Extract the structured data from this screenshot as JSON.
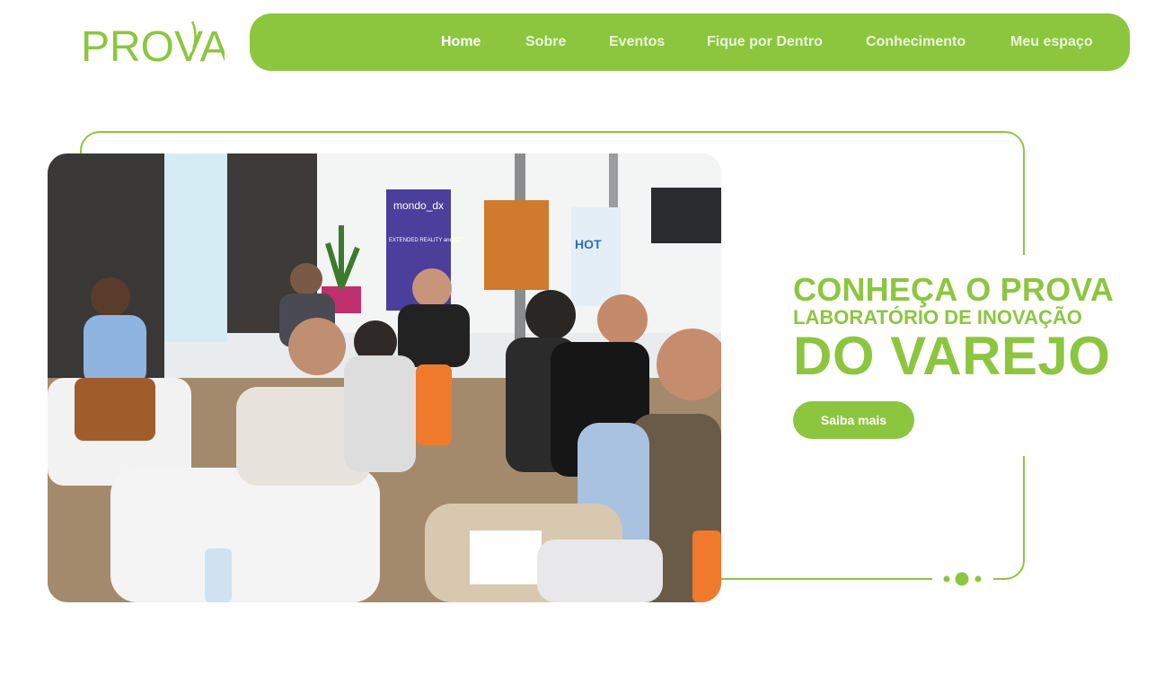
{
  "brand": {
    "logo_text": "PROVA",
    "primary_color": "#8cc63f",
    "nav_text_color": "#ffffff"
  },
  "nav": {
    "items": [
      {
        "label": "Home",
        "active": true
      },
      {
        "label": "Sobre",
        "active": false
      },
      {
        "label": "Eventos",
        "active": false
      },
      {
        "label": "Fique por Dentro",
        "active": false
      },
      {
        "label": "Conhecimento",
        "active": false
      },
      {
        "label": "Meu espaço",
        "active": false
      }
    ]
  },
  "hero": {
    "headline_line1": "CONHEÇA O PROVA",
    "headline_line2": "LABORATÓRIO DE INOVAÇÃO",
    "headline_line3": "DO VAREJO",
    "cta_label": "Saiba mais",
    "image_icon": "event-audience-photo",
    "image_banner_texts": [
      "mondo_dx",
      "EXTENDED REALITY and IOT",
      "HOT"
    ],
    "carousel_indicator_icon": "slider-dots-icon"
  }
}
